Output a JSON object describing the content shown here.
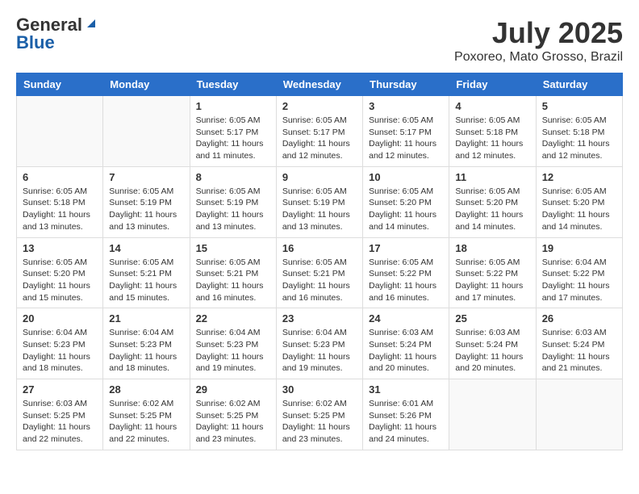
{
  "logo": {
    "general": "General",
    "blue": "Blue"
  },
  "title": {
    "month": "July 2025",
    "location": "Poxoreo, Mato Grosso, Brazil"
  },
  "headers": [
    "Sunday",
    "Monday",
    "Tuesday",
    "Wednesday",
    "Thursday",
    "Friday",
    "Saturday"
  ],
  "weeks": [
    [
      {
        "day": "",
        "info": ""
      },
      {
        "day": "",
        "info": ""
      },
      {
        "day": "1",
        "info": "Sunrise: 6:05 AM\nSunset: 5:17 PM\nDaylight: 11 hours and 11 minutes."
      },
      {
        "day": "2",
        "info": "Sunrise: 6:05 AM\nSunset: 5:17 PM\nDaylight: 11 hours and 12 minutes."
      },
      {
        "day": "3",
        "info": "Sunrise: 6:05 AM\nSunset: 5:17 PM\nDaylight: 11 hours and 12 minutes."
      },
      {
        "day": "4",
        "info": "Sunrise: 6:05 AM\nSunset: 5:18 PM\nDaylight: 11 hours and 12 minutes."
      },
      {
        "day": "5",
        "info": "Sunrise: 6:05 AM\nSunset: 5:18 PM\nDaylight: 11 hours and 12 minutes."
      }
    ],
    [
      {
        "day": "6",
        "info": "Sunrise: 6:05 AM\nSunset: 5:18 PM\nDaylight: 11 hours and 13 minutes."
      },
      {
        "day": "7",
        "info": "Sunrise: 6:05 AM\nSunset: 5:19 PM\nDaylight: 11 hours and 13 minutes."
      },
      {
        "day": "8",
        "info": "Sunrise: 6:05 AM\nSunset: 5:19 PM\nDaylight: 11 hours and 13 minutes."
      },
      {
        "day": "9",
        "info": "Sunrise: 6:05 AM\nSunset: 5:19 PM\nDaylight: 11 hours and 13 minutes."
      },
      {
        "day": "10",
        "info": "Sunrise: 6:05 AM\nSunset: 5:20 PM\nDaylight: 11 hours and 14 minutes."
      },
      {
        "day": "11",
        "info": "Sunrise: 6:05 AM\nSunset: 5:20 PM\nDaylight: 11 hours and 14 minutes."
      },
      {
        "day": "12",
        "info": "Sunrise: 6:05 AM\nSunset: 5:20 PM\nDaylight: 11 hours and 14 minutes."
      }
    ],
    [
      {
        "day": "13",
        "info": "Sunrise: 6:05 AM\nSunset: 5:20 PM\nDaylight: 11 hours and 15 minutes."
      },
      {
        "day": "14",
        "info": "Sunrise: 6:05 AM\nSunset: 5:21 PM\nDaylight: 11 hours and 15 minutes."
      },
      {
        "day": "15",
        "info": "Sunrise: 6:05 AM\nSunset: 5:21 PM\nDaylight: 11 hours and 16 minutes."
      },
      {
        "day": "16",
        "info": "Sunrise: 6:05 AM\nSunset: 5:21 PM\nDaylight: 11 hours and 16 minutes."
      },
      {
        "day": "17",
        "info": "Sunrise: 6:05 AM\nSunset: 5:22 PM\nDaylight: 11 hours and 16 minutes."
      },
      {
        "day": "18",
        "info": "Sunrise: 6:05 AM\nSunset: 5:22 PM\nDaylight: 11 hours and 17 minutes."
      },
      {
        "day": "19",
        "info": "Sunrise: 6:04 AM\nSunset: 5:22 PM\nDaylight: 11 hours and 17 minutes."
      }
    ],
    [
      {
        "day": "20",
        "info": "Sunrise: 6:04 AM\nSunset: 5:23 PM\nDaylight: 11 hours and 18 minutes."
      },
      {
        "day": "21",
        "info": "Sunrise: 6:04 AM\nSunset: 5:23 PM\nDaylight: 11 hours and 18 minutes."
      },
      {
        "day": "22",
        "info": "Sunrise: 6:04 AM\nSunset: 5:23 PM\nDaylight: 11 hours and 19 minutes."
      },
      {
        "day": "23",
        "info": "Sunrise: 6:04 AM\nSunset: 5:23 PM\nDaylight: 11 hours and 19 minutes."
      },
      {
        "day": "24",
        "info": "Sunrise: 6:03 AM\nSunset: 5:24 PM\nDaylight: 11 hours and 20 minutes."
      },
      {
        "day": "25",
        "info": "Sunrise: 6:03 AM\nSunset: 5:24 PM\nDaylight: 11 hours and 20 minutes."
      },
      {
        "day": "26",
        "info": "Sunrise: 6:03 AM\nSunset: 5:24 PM\nDaylight: 11 hours and 21 minutes."
      }
    ],
    [
      {
        "day": "27",
        "info": "Sunrise: 6:03 AM\nSunset: 5:25 PM\nDaylight: 11 hours and 22 minutes."
      },
      {
        "day": "28",
        "info": "Sunrise: 6:02 AM\nSunset: 5:25 PM\nDaylight: 11 hours and 22 minutes."
      },
      {
        "day": "29",
        "info": "Sunrise: 6:02 AM\nSunset: 5:25 PM\nDaylight: 11 hours and 23 minutes."
      },
      {
        "day": "30",
        "info": "Sunrise: 6:02 AM\nSunset: 5:25 PM\nDaylight: 11 hours and 23 minutes."
      },
      {
        "day": "31",
        "info": "Sunrise: 6:01 AM\nSunset: 5:26 PM\nDaylight: 11 hours and 24 minutes."
      },
      {
        "day": "",
        "info": ""
      },
      {
        "day": "",
        "info": ""
      }
    ]
  ]
}
